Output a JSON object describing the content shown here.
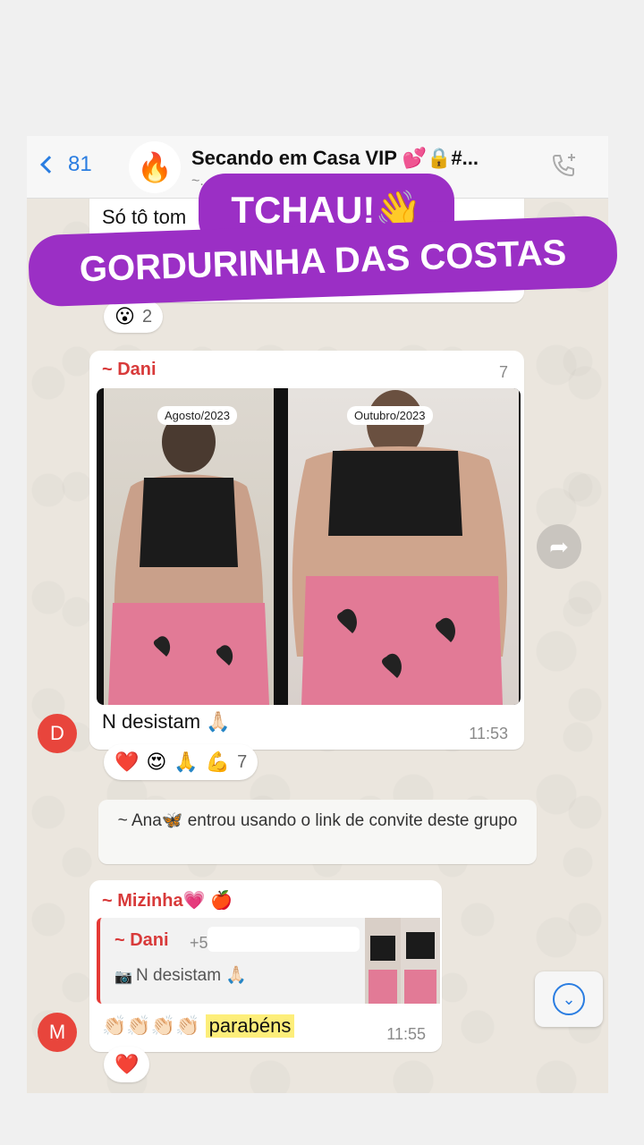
{
  "header": {
    "back_count": "81",
    "group_avatar": "🔥",
    "title": "Secando em Casa VIP 💕🔒#...",
    "subtitle": "~..., ~...da, ~5511..."
  },
  "overlay": {
    "line1": "TCHAU!👋",
    "line2": "GORDURINHA DAS COSTAS"
  },
  "top_bubble": {
    "text": "Só tô tom",
    "reaction": "😮",
    "reaction_count": "2"
  },
  "dani_message": {
    "sender": "~ Dani",
    "time_top": "7",
    "photo_left_label": "Agosto/2023",
    "photo_right_label": "Outubro/2023",
    "text": "N desistam 🙏🏻",
    "time": "11:53",
    "avatar_letter": "D",
    "reactions": [
      "❤️",
      "😍",
      "🙏",
      "💪"
    ],
    "reaction_count": "7"
  },
  "system_message": {
    "text": "~ Ana🦋 entrou usando o link de convite deste grupo"
  },
  "mizinha_message": {
    "sender": "~ Mizinha💗 🍎",
    "quote_sender": "~ Dani",
    "quote_phone": "+5",
    "quote_text": "N desistam 🙏🏻",
    "text_emojis": "👏🏻👏🏻👏🏻👏🏻",
    "text_highlight": "parabéns",
    "time": "11:55",
    "avatar_letter": "M",
    "reaction": "❤️"
  },
  "icons": {
    "call": "phone-plus-icon",
    "forward": "forward-icon",
    "scroll_down": "chevron-down-icon",
    "camera": "camera-icon"
  },
  "colors": {
    "accent": "#2a7de1",
    "sender": "#d83a3a",
    "sticker": "#9b2fc5",
    "avatar": "#e8453c"
  }
}
